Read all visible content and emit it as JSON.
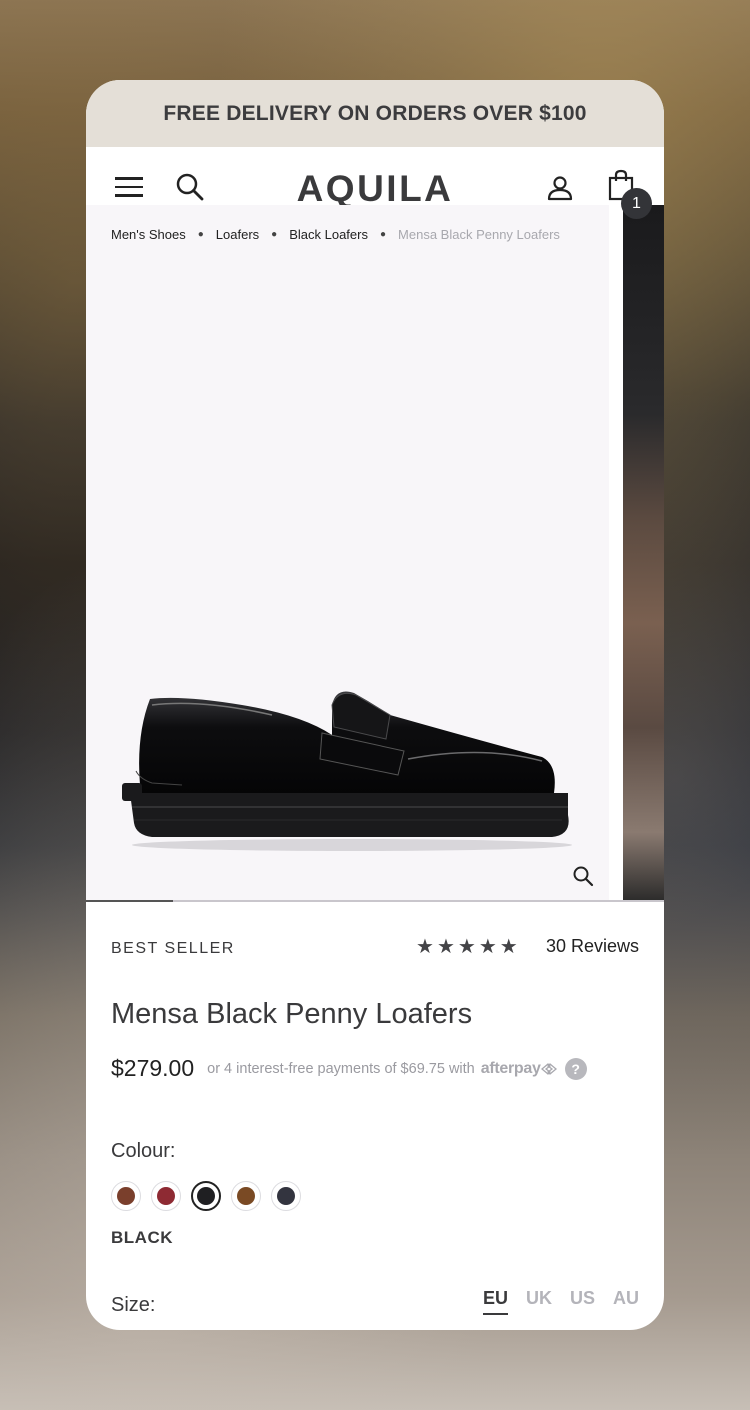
{
  "promo": {
    "text": "FREE DELIVERY ON ORDERS OVER $100"
  },
  "header": {
    "logo": "AQUILA",
    "cart_count": "1",
    "icons": [
      "menu-icon",
      "search-icon",
      "user-icon",
      "shopping-bag-icon"
    ]
  },
  "breadcrumb": {
    "items": [
      "Men's Shoes",
      "Loafers",
      "Black Loafers"
    ],
    "current": "Mensa Black Penny Loafers"
  },
  "gallery": {
    "progress_fraction": 0.15
  },
  "product": {
    "badge": "BEST SELLER",
    "rating": 5,
    "reviews": "30 Reviews",
    "title": "Mensa Black Penny Loafers",
    "price": "$279.00",
    "afterpay_text": "or 4 interest-free payments of $69.75 with",
    "afterpay_logo": "afterpay",
    "help": "?"
  },
  "colour": {
    "label": "Colour:",
    "selected_name": "BLACK",
    "swatches": [
      "#7a3f2c",
      "#8e2a33",
      "#1f1f22",
      "#7a4a24",
      "#33343f"
    ],
    "selected_index": 2
  },
  "size": {
    "label": "Size:",
    "systems": [
      "EU",
      "UK",
      "US",
      "AU"
    ],
    "active": "EU"
  }
}
